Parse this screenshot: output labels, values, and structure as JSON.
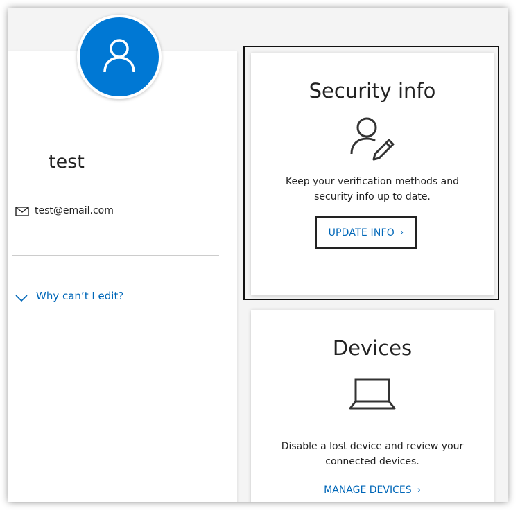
{
  "profile": {
    "name": "test",
    "email": "test@email.com",
    "why_cant_edit": "Why can’t I edit?"
  },
  "security_info": {
    "title": "Security info",
    "description": "Keep your verification methods and security info up to date.",
    "button_label": "UPDATE INFO",
    "button_chevron": "›"
  },
  "devices": {
    "title": "Devices",
    "description": "Disable a lost device and review your connected devices.",
    "link_label": "MANAGE DEVICES",
    "link_chevron": "›"
  },
  "icons": {
    "avatar": "person-icon",
    "email": "mail-icon",
    "expand": "chevron-down-icon",
    "security": "person-edit-icon",
    "devices": "laptop-icon"
  },
  "colors": {
    "accent": "#0078d4",
    "link": "#0067b8",
    "background": "#f4f4f4",
    "card": "#ffffff",
    "text": "#222222"
  }
}
